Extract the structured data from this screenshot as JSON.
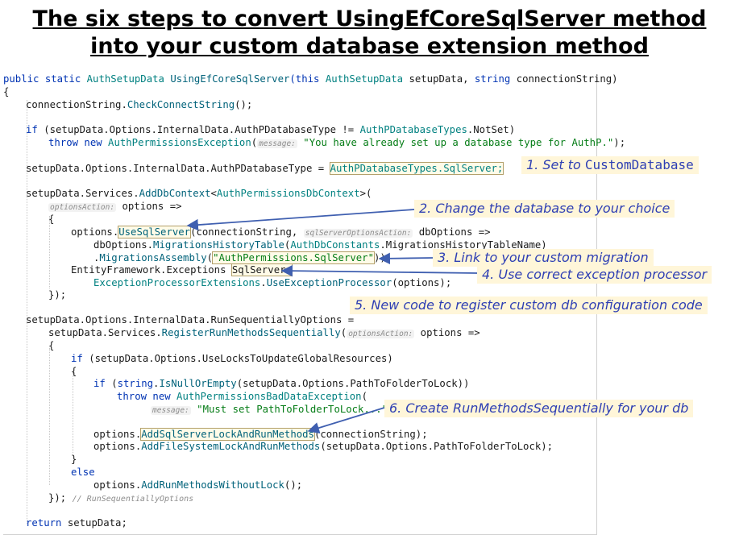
{
  "title": {
    "line1": "The six steps to convert UsingEfCoreSqlServer method",
    "line2": "into your custom database extension method"
  },
  "code": {
    "l1": {
      "a": "public static ",
      "b": "AuthSetupData ",
      "c": "UsingEfCoreSqlServer",
      "d": "(this ",
      "e": "AuthSetupData",
      "f": " setupData, ",
      "g": "string",
      "h": " connectionString)"
    },
    "l2": "{",
    "l3": {
      "a": "connectionString.",
      "b": "CheckConnectString",
      "c": "();"
    },
    "l4": {
      "a": "if ",
      "b": "(setupData.Options.InternalData.AuthPDatabaseType != ",
      "c": "AuthPDatabaseTypes",
      "d": ".NotSet)"
    },
    "l5": {
      "a": "throw new ",
      "b": "AuthPermissionsException",
      "c": "(",
      "h": "message:",
      "d": " \"You have already set up a database type for AuthP.\"",
      "e": ");"
    },
    "l6": {
      "a": "setupData.Options.InternalData.AuthPDatabaseType = ",
      "b": "AuthPDatabaseTypes.SqlServer;"
    },
    "l7": {
      "a": "setupData.Services.",
      "b": "AddDbContext",
      "c": "<",
      "d": "AuthPermissionsDbContext",
      "e": ">("
    },
    "l8": {
      "h": "optionsAction:",
      "a": " options =>"
    },
    "l9": "{",
    "l10": {
      "a": "options.",
      "b": "UseSqlServer",
      "c": "(connectionString, ",
      "h": "sqlServerOptionsAction:",
      "d": " dbOptions =>"
    },
    "l11": {
      "a": "dbOptions.",
      "b": "MigrationsHistoryTable",
      "c": "(",
      "d": "AuthDbConstants",
      "e": ".MigrationsHistoryTableName)"
    },
    "l12": {
      "a": ".",
      "b": "MigrationsAssembly",
      "c": "(",
      "d": "\"AuthPermissions.SqlServer\"",
      "e": "));"
    },
    "l13": {
      "a": "EntityFramework.Exceptions ",
      "b": "SqlServer."
    },
    "l14": {
      "a": "ExceptionProcessorExtensions",
      "b": ".",
      "c": "UseExceptionProcessor",
      "d": "(options);"
    },
    "l15": "});",
    "l16": "setupData.Options.InternalData.RunSequentiallyOptions =",
    "l17": {
      "a": "setupData.Services.",
      "b": "RegisterRunMethodsSequentially",
      "c": "(",
      "h": "optionsAction:",
      "d": " options =>"
    },
    "l18": "{",
    "l19": {
      "a": "if ",
      "b": "(setupData.Options.UseLocksToUpdateGlobalResources)"
    },
    "l20": "{",
    "l21": {
      "a": "if ",
      "b": "(",
      "c": "string",
      "d": ".",
      "e": "IsNullOrEmpty",
      "f": "(setupData.Options.PathToFolderToLock))"
    },
    "l22": {
      "a": "throw new ",
      "b": "AuthPermissionsBadDataException",
      "c": "("
    },
    "l23": {
      "h": "message:",
      "a": " \"Must set PathToFolderToLock...\"",
      "b": ");"
    },
    "l24": {
      "a": "options.",
      "b": "AddSqlServerLockAndRunMethods",
      "c": "(connectionString);"
    },
    "l25": {
      "a": "options.",
      "b": "AddFileSystemLockAndRunMethods",
      "c": "(setupData.Options.PathToFolderToLock);"
    },
    "l26": "}",
    "l27": "else",
    "l28": {
      "a": "options.",
      "b": "AddRunMethodsWithoutLock",
      "c": "();"
    },
    "l29": {
      "a": "});",
      "c": "// RunSequentiallyOptions"
    },
    "l30": {
      "a": "return ",
      "b": "setupData;"
    }
  },
  "annotations": {
    "a1_prefix": "1. Set to ",
    "a1_code": "CustomDatabase",
    "a2": "2. Change the database to your choice",
    "a3": "3. Link to your custom migration",
    "a4": "4. Use correct exception  processor",
    "a5": "5. New code to register custom db configuration code",
    "a6": "6. Create RunMethodsSequentially for your db"
  },
  "colors": {
    "annotation_text": "#2e3fb4",
    "annotation_bg": "#fff6d9",
    "arrow": "#3f5fb0"
  }
}
